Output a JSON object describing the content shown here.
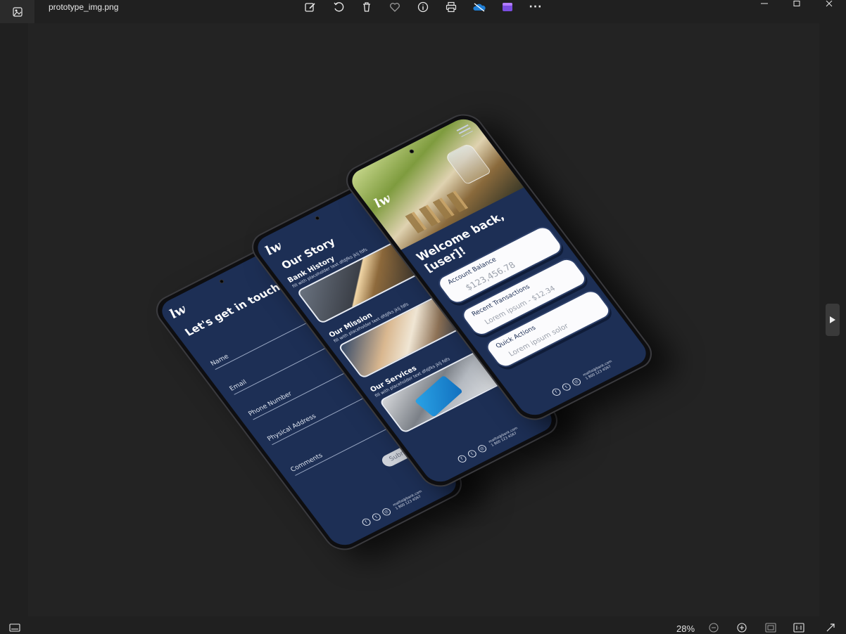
{
  "window": {
    "filename": "prototype_img.png"
  },
  "toolbar": {
    "icons": [
      "edit-image-icon",
      "rotate-icon",
      "delete-icon",
      "favorite-icon",
      "info-icon",
      "print-icon",
      "onedrive-icon",
      "clipchamp-icon",
      "more-icon"
    ],
    "more_label": "···"
  },
  "statusbar": {
    "zoom": "28%"
  },
  "contact_screen": {
    "title": "Let's get in touch",
    "fields": [
      "Name",
      "Email",
      "Phone Number",
      "Physical Address",
      "Comments"
    ],
    "submit_label": "Submit",
    "footer": {
      "email": "mailto@bank.com",
      "phone": "1 800 123 4567"
    }
  },
  "story_screen": {
    "title": "Our Story",
    "sections": [
      {
        "title": "Bank History",
        "desc": "fill with placeholder text dfdjfks jklj fdfs"
      },
      {
        "title": "Our Mission",
        "desc": "fill with placeholder text dfdjfks jklj fdfs"
      },
      {
        "title": "Our Services",
        "desc": "fill with placeholder text dfdjfks jklj fdfs"
      }
    ],
    "footer": {
      "email": "mailto@bank.com",
      "phone": "1 800 123 4567"
    }
  },
  "welcome_screen": {
    "title": "Welcome back, [user]!",
    "cards": [
      {
        "label": "Account Balance",
        "value": "$123,456.78"
      },
      {
        "label": "Recent Transactions",
        "value": "Lorem ipsum - $12.34"
      },
      {
        "label": "Quick Actions",
        "value": "Lorem ipsum solor"
      }
    ],
    "footer": {
      "email": "mailto@bank.com",
      "phone": "1 800 123 4567"
    }
  },
  "brand": {
    "logo_text": "lw",
    "navy": "#1d2f55",
    "card_white": "#fbfbfd"
  }
}
